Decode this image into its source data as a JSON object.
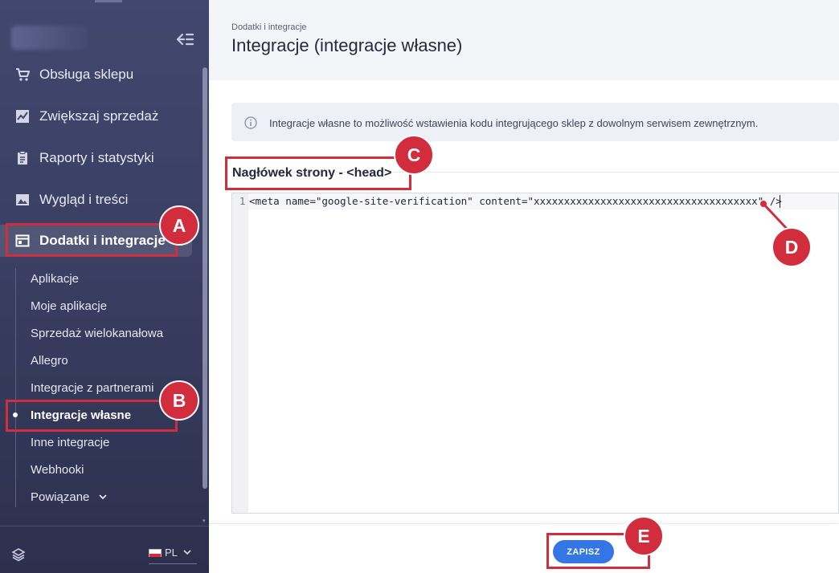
{
  "sidebar": {
    "menu": [
      {
        "label": "Obsługa sklepu",
        "icon": "cart-icon"
      },
      {
        "label": "Zwiększaj sprzedaż",
        "icon": "chart-line-icon"
      },
      {
        "label": "Raporty i statystyki",
        "icon": "clipboard-icon"
      },
      {
        "label": "Wygląd i treści",
        "icon": "image-icon"
      },
      {
        "label": "Dodatki i integracje",
        "icon": "browser-window-icon",
        "active": true
      }
    ],
    "submenu": [
      {
        "label": "Aplikacje"
      },
      {
        "label": "Moje aplikacje"
      },
      {
        "label": "Sprzedaż wielokanałowa"
      },
      {
        "label": "Allegro"
      },
      {
        "label": "Integracje z partnerami"
      },
      {
        "label": "Integracje własne",
        "current": true
      },
      {
        "label": "Inne integracje"
      },
      {
        "label": "Webhooki"
      },
      {
        "label": "Powiązane"
      }
    ],
    "language": "PL"
  },
  "header": {
    "breadcrumb": "Dodatki i integracje",
    "title": "Integracje (integracje własne)"
  },
  "info": {
    "text": "Integracje własne to możliwość wstawienia kodu integrującego sklep z dowolnym serwisem zewnętrznym."
  },
  "section": {
    "title": "Nagłówek strony - <head>"
  },
  "editor": {
    "line_number": "1",
    "code": "<meta name=\"google-site-verification\" content=\"xxxxxxxxxxxxxxxxxxxxxxxxxxxxxxxxxxxxx\" />"
  },
  "actions": {
    "save_label": "ZAPISZ"
  },
  "annotations": {
    "a": "A",
    "b": "B",
    "c": "C",
    "d": "D",
    "e": "E"
  },
  "colors": {
    "sidebar_bg": "#3a3f63",
    "accent": "#3476e5",
    "annotation": "#d22d3d"
  }
}
